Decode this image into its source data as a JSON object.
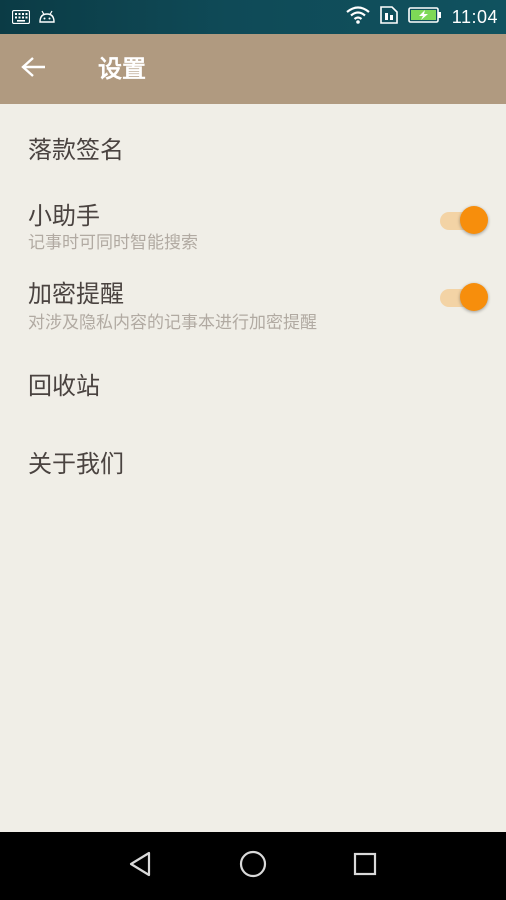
{
  "status_bar": {
    "time": "11:04",
    "icons": [
      "keyboard-icon",
      "android-icon",
      "wifi-icon",
      "sim-icon",
      "battery-charging-icon"
    ]
  },
  "toolbar": {
    "title": "设置",
    "back_icon": "arrow-left-icon",
    "background": "#b09a80"
  },
  "settings": {
    "items": [
      {
        "title": "落款签名"
      },
      {
        "title": "小助手",
        "subtitle": "记事时可同时智能搜索",
        "toggle": true
      },
      {
        "title": "加密提醒",
        "subtitle": "对涉及隐私内容的记事本进行加密提醒",
        "toggle": true
      },
      {
        "title": "回收站"
      },
      {
        "title": "关于我们"
      }
    ]
  },
  "colors": {
    "accent": "#f78e0c",
    "toggle_track": "#f3d3a5",
    "page_background": "#f0eee7"
  },
  "nav_bar": {
    "icons": [
      "back-triangle-icon",
      "home-circle-icon",
      "recents-square-icon"
    ]
  }
}
